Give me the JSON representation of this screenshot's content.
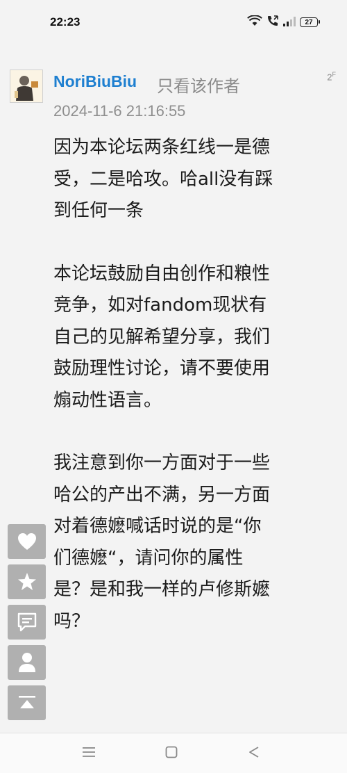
{
  "status_bar": {
    "time": "22:23",
    "battery": "27"
  },
  "post": {
    "author": "NoriBiuBiu",
    "only_author_label": "只看该作者",
    "floor": "2",
    "floor_suffix": "F",
    "date": "2024-11-6 21:16:55",
    "paragraphs": [
      [
        "因为本论坛两条红线一是德",
        "受，二是哈攻。哈all没有踩",
        "到任何一条"
      ],
      [
        "本论坛鼓励自由创作和粮性",
        "竞争，如对fandom现状有",
        "自己的见解希望分享，我们",
        "鼓励理性讨论，请不要使用",
        "煽动性语言。"
      ],
      [
        "我注意到你一方面对于一些",
        "哈公的产出不满，另一方面",
        "对着德嬷喊话时说的是“你",
        "们德嬷“，请问你的属性",
        "是？是和我一样的卢修斯嬷",
        "吗？"
      ]
    ]
  },
  "side_buttons": [
    "heart-icon",
    "star-icon",
    "comment-icon",
    "user-icon",
    "back-to-top-icon"
  ],
  "nav_bar": [
    "menu-icon",
    "home-icon",
    "back-icon"
  ],
  "colors": {
    "author": "#1e7fd0",
    "background": "#f3f3f3",
    "side_button": "#b0b0b0"
  }
}
